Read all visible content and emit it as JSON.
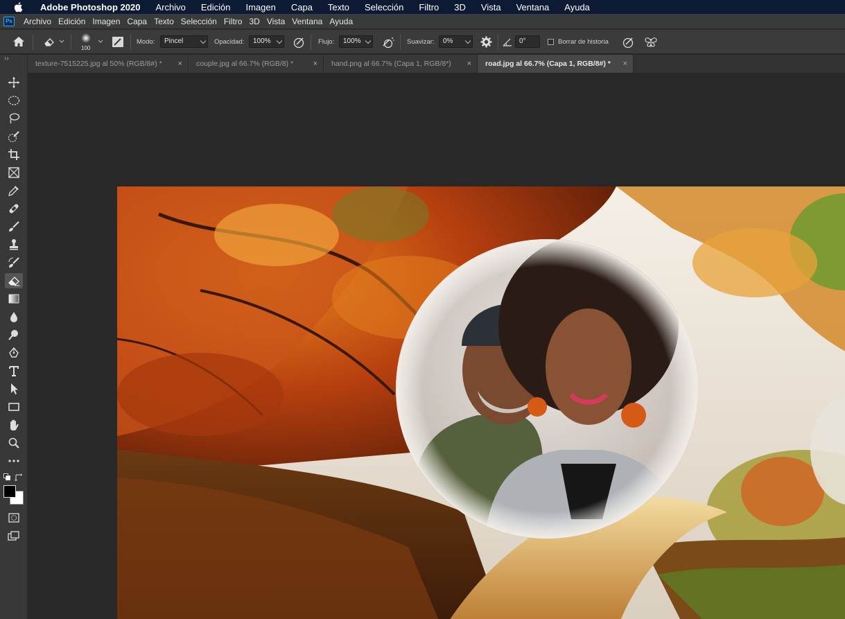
{
  "mac_menu": {
    "app_name": "Adobe Photoshop 2020",
    "items": [
      "Archivo",
      "Edición",
      "Imagen",
      "Capa",
      "Texto",
      "Selección",
      "Filtro",
      "3D",
      "Vista",
      "Ventana",
      "Ayuda"
    ]
  },
  "ps_menu": {
    "logo": "Ps",
    "items": [
      "Archivo",
      "Edición",
      "Imagen",
      "Capa",
      "Texto",
      "Selección",
      "Filtro",
      "3D",
      "Vista",
      "Ventana",
      "Ayuda"
    ]
  },
  "options": {
    "brush_size": "100",
    "mode_label": "Modo:",
    "mode_value": "Pincel",
    "opacity_label": "Opacidad:",
    "opacity_value": "100%",
    "flow_label": "Flujo:",
    "flow_value": "100%",
    "smoothing_label": "Suavizar:",
    "smoothing_value": "0%",
    "angle_value": "0°",
    "erase_history_label": "Borrar de historia"
  },
  "tabs": [
    {
      "label": "texture-7515225.jpg al 50% (RGB/8#) *",
      "active": false
    },
    {
      "label": "couple.jpg al 66.7% (RGB/8) *",
      "active": false
    },
    {
      "label": "hand.png al 66.7% (Capa 1, RGB/8*)",
      "active": false
    },
    {
      "label": "road.jpg al 66.7% (Capa 1, RGB/8#) *",
      "active": true
    }
  ],
  "tab_close_glyph": "×",
  "toolbar_expand": "››",
  "tools": [
    "move-tool",
    "ellipse-marquee-tool",
    "lasso-tool",
    "quick-selection-tool",
    "crop-tool",
    "frame-tool",
    "eyedropper-tool",
    "healing-brush-tool",
    "brush-tool",
    "clone-stamp-tool",
    "history-brush-tool",
    "eraser-tool",
    "gradient-tool",
    "blur-tool",
    "dodge-tool",
    "pen-tool",
    "type-tool",
    "path-selection-tool",
    "rectangle-tool",
    "hand-tool",
    "zoom-tool",
    "more-tools"
  ],
  "active_tool": "eraser-tool",
  "colors": {
    "foreground": "#000000",
    "background": "#ffffff",
    "accent": "#31a8ff"
  }
}
